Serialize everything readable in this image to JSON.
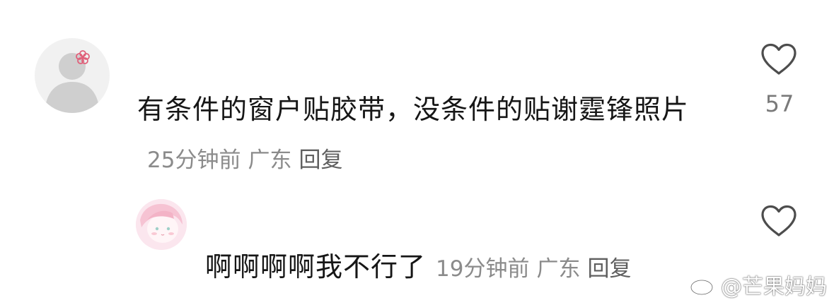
{
  "comments": [
    {
      "text": "有条件的窗户贴胶带，没条件的贴谢霆锋照片",
      "time": "25分钟前",
      "location": "广东",
      "reply": "回复",
      "likes": "57"
    },
    {
      "text": "啊啊啊啊我不行了",
      "time": "19分钟前",
      "location": "广东",
      "reply": "回复",
      "likes": ""
    }
  ],
  "watermark": {
    "text": "@芒果妈妈",
    "icon": "weibo-logo-icon"
  },
  "icons": {
    "like": "heart-outline-icon",
    "flower": "flower-icon"
  },
  "colors": {
    "text": "#161616",
    "meta": "#8b8b8b",
    "icon": "#4d4d4d",
    "avatar_bg": "#f1f1f1",
    "avatar_silhouette": "#cfcfcf",
    "flower": "#e0607a"
  }
}
